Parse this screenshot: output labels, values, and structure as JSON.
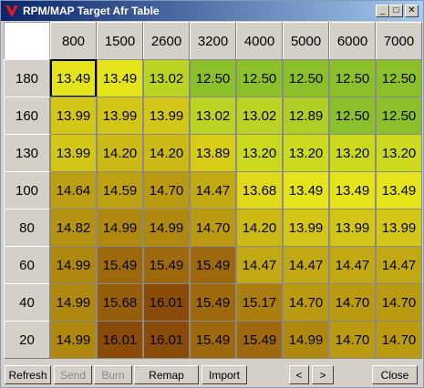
{
  "window": {
    "title": "RPM/MAP Target Afr Table"
  },
  "table": {
    "rpm": [
      "800",
      "1500",
      "2600",
      "3200",
      "4000",
      "5000",
      "6000",
      "7000"
    ],
    "map": [
      "180",
      "160",
      "130",
      "100",
      "80",
      "60",
      "40",
      "20"
    ],
    "values": [
      [
        "13.49",
        "13.49",
        "13.02",
        "12.50",
        "12.50",
        "12.50",
        "12.50",
        "12.50"
      ],
      [
        "13.99",
        "13.99",
        "13.99",
        "13.02",
        "13.02",
        "12.89",
        "12.50",
        "12.50"
      ],
      [
        "13.99",
        "14.20",
        "14.20",
        "13.89",
        "13.20",
        "13.20",
        "13.20",
        "13.20"
      ],
      [
        "14.64",
        "14.59",
        "14.70",
        "14.47",
        "13.68",
        "13.49",
        "13.49",
        "13.49"
      ],
      [
        "14.82",
        "14.99",
        "14.99",
        "14.70",
        "14.20",
        "13.99",
        "13.99",
        "13.99"
      ],
      [
        "14.99",
        "15.49",
        "15.49",
        "15.49",
        "14.47",
        "14.47",
        "14.47",
        "14.47"
      ],
      [
        "14.99",
        "15.68",
        "16.01",
        "15.49",
        "15.17",
        "14.70",
        "14.70",
        "14.70"
      ],
      [
        "14.99",
        "16.01",
        "16.01",
        "15.49",
        "15.49",
        "14.99",
        "14.70",
        "14.70"
      ]
    ],
    "selected_cell": "13.49"
  },
  "buttons": {
    "refresh": "Refresh",
    "send": "Send",
    "burn": "Burn",
    "remap": "Remap",
    "import": "Import",
    "prev": "<",
    "next": ">",
    "close": "Close"
  },
  "colors": {
    "low_afr": "#8cc02a",
    "mid_afr": "#e6e41a",
    "high_afr": "#8a4a08"
  }
}
